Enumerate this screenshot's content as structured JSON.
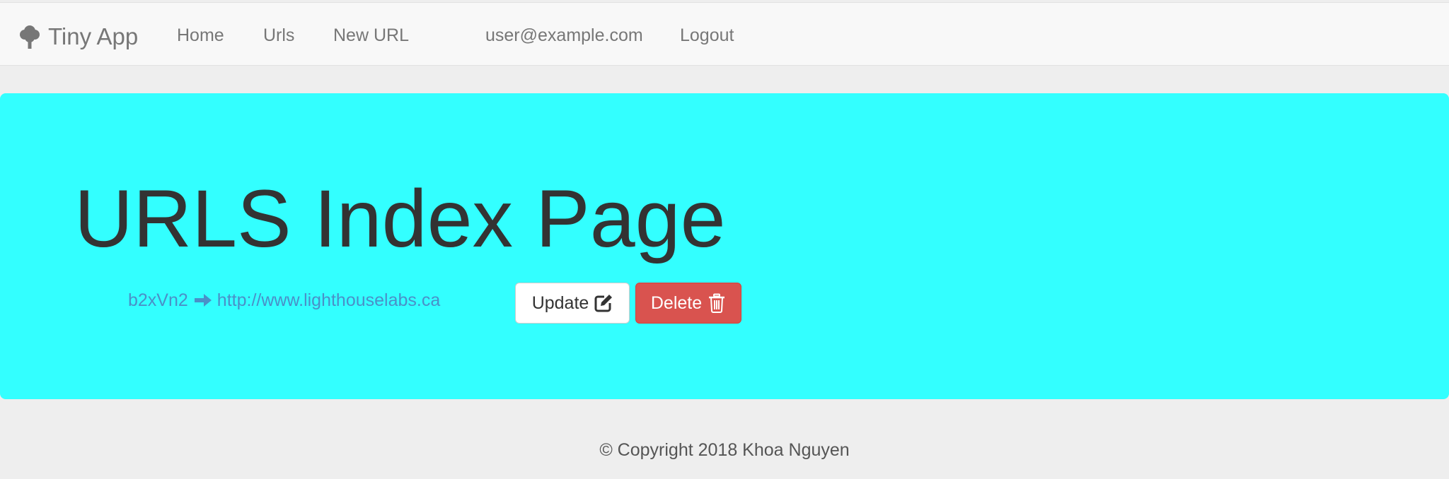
{
  "navbar": {
    "brand": "Tiny App",
    "brand_icon": "tree-icon",
    "links": {
      "home": "Home",
      "urls": "Urls",
      "new_url": "New URL"
    },
    "user_email": "user@example.com",
    "logout": "Logout"
  },
  "main": {
    "title": "URLS Index Page",
    "background_color": "#33ffff",
    "urls": [
      {
        "short_url": "b2xVn2",
        "arrow_icon": "arrow-right-icon",
        "long_url": "http://www.lighthouselabs.ca",
        "update_label": "Update",
        "update_icon": "edit-icon",
        "delete_label": "Delete",
        "delete_icon": "trash-icon"
      }
    ]
  },
  "footer": {
    "copyright": "© Copyright 2018 Khoa Nguyen"
  }
}
